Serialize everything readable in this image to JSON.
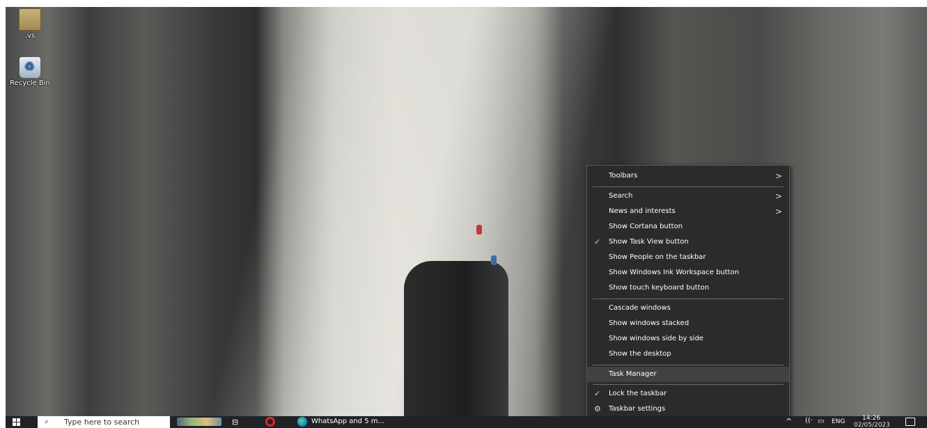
{
  "desktop": {
    "icons": [
      {
        "label": ".vs",
        "icon": "folder-icon"
      },
      {
        "label": "Recycle Bin",
        "icon": "recycle-bin-icon"
      }
    ]
  },
  "context_menu": {
    "items": [
      {
        "label": "Toolbars",
        "submenu": true
      },
      {
        "label": "Search",
        "submenu": true
      },
      {
        "label": "News and interests",
        "submenu": true
      },
      {
        "label": "Show Cortana button"
      },
      {
        "label": "Show Task View button",
        "checked": true
      },
      {
        "label": "Show People on the taskbar"
      },
      {
        "label": "Show Windows Ink Workspace button"
      },
      {
        "label": "Show touch keyboard button"
      },
      {
        "label": "Cascade windows"
      },
      {
        "label": "Show windows stacked"
      },
      {
        "label": "Show windows side by side"
      },
      {
        "label": "Show the desktop"
      },
      {
        "label": "Task Manager",
        "highlighted": true
      },
      {
        "label": "Lock the taskbar",
        "checked": true
      },
      {
        "label": "Taskbar settings",
        "icon": "gear-icon"
      }
    ],
    "check_glyph": "✓",
    "arrow_glyph": ">",
    "gear_glyph": "⚙"
  },
  "taskbar": {
    "search_placeholder": "Type here to search",
    "apps": [
      {
        "label": "WhatsApp and 5 m...",
        "icon": "edge-icon"
      }
    ],
    "tray": {
      "language": "ENG",
      "time": "14:26",
      "date": "02/05/2023"
    }
  },
  "colors": {
    "menu_bg": "#2b2b2b",
    "menu_highlight": "#414141",
    "taskbar_bg": "#1f2326"
  }
}
